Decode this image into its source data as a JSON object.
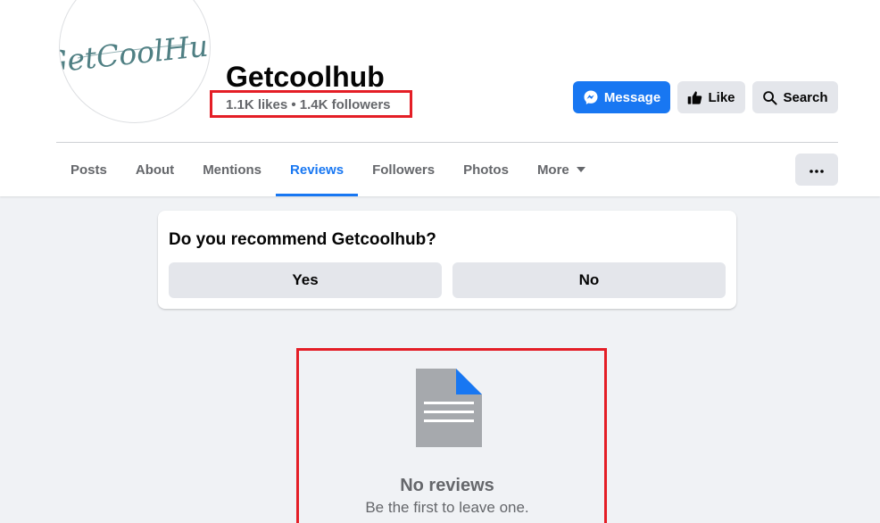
{
  "page": {
    "logo_text": "GetCoolHub",
    "name": "Getcoolhub",
    "stats": "1.1K likes • 1.4K followers"
  },
  "actions": {
    "message_label": "Message",
    "like_label": "Like",
    "search_label": "Search"
  },
  "tabs": [
    {
      "label": "Posts"
    },
    {
      "label": "About"
    },
    {
      "label": "Mentions"
    },
    {
      "label": "Reviews",
      "active": true
    },
    {
      "label": "Followers"
    },
    {
      "label": "Photos"
    },
    {
      "label": "More"
    }
  ],
  "more_menu_icon": "three-dots-icon",
  "recommend": {
    "question": "Do you recommend Getcoolhub?",
    "yes_label": "Yes",
    "no_label": "No"
  },
  "empty_state": {
    "icon": "document-icon",
    "title": "No reviews",
    "subtitle": "Be the first to leave one."
  },
  "colors": {
    "brand_blue": "#1877f2",
    "highlight_red": "#e41e26",
    "secondary_text": "#65676b",
    "button_gray": "#e4e6eb",
    "logo_teal": "#4f7f83"
  }
}
